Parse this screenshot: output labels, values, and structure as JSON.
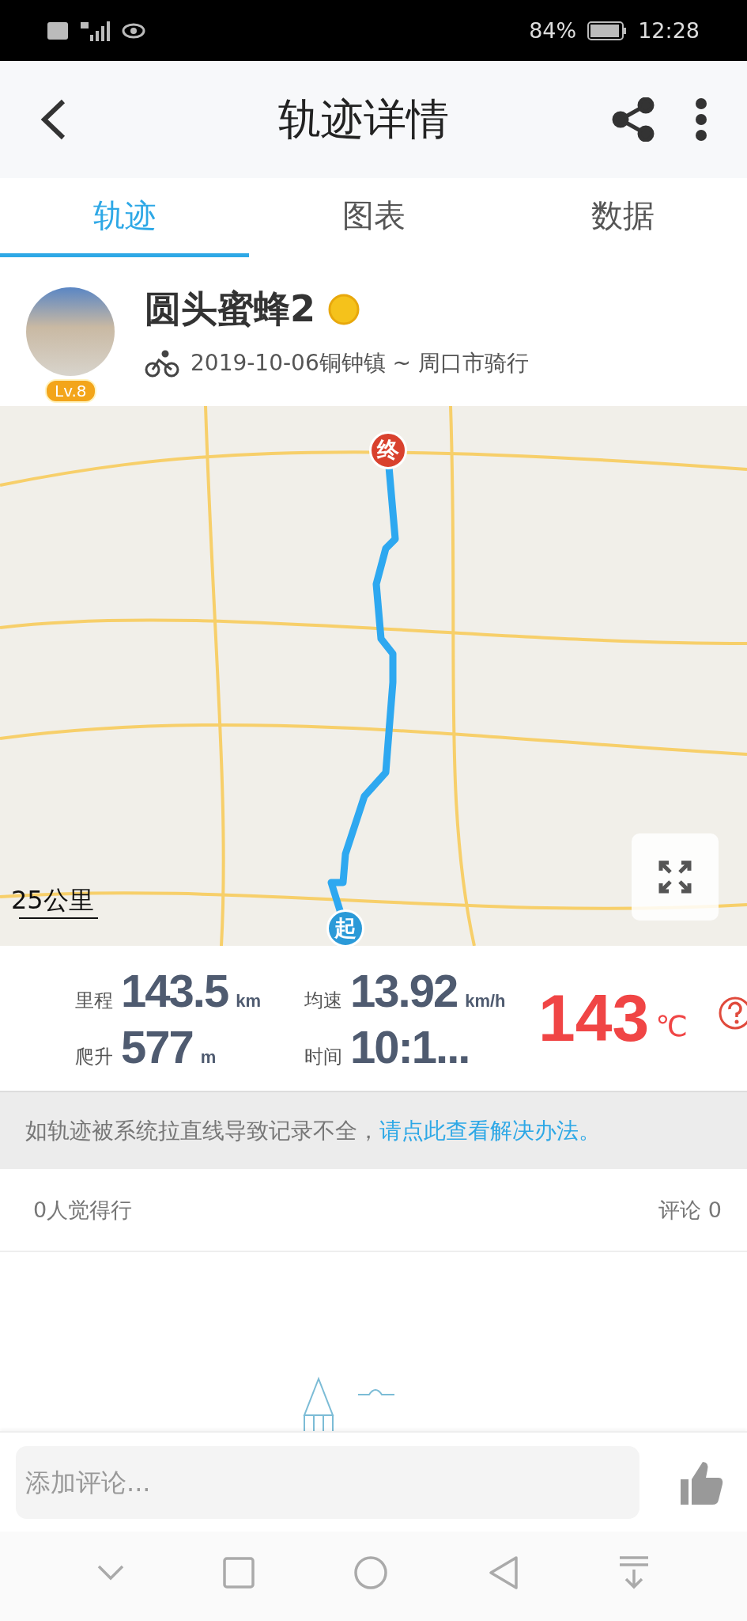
{
  "status_bar": {
    "battery": "84%",
    "time": "12:28"
  },
  "header": {
    "title": "轨迹详情"
  },
  "tabs": [
    {
      "label": "轨迹",
      "selected": true
    },
    {
      "label": "图表",
      "selected": false
    },
    {
      "label": "数据",
      "selected": false
    }
  ],
  "profile": {
    "name": "圆头蜜蜂2",
    "level": "Lv.8",
    "subtitle": "2019-10-06铜钟镇 ~ 周口市骑行"
  },
  "map": {
    "end_label": "终",
    "start_label": "起",
    "scale": "25公里"
  },
  "stats": [
    {
      "label": "里程",
      "value": "143.5",
      "unit": "km"
    },
    {
      "label": "均速",
      "value": "13.92",
      "unit": "km/h"
    },
    {
      "label": "爬升",
      "value": "577",
      "unit": "m"
    },
    {
      "label": "时间",
      "value": "10:1..."
    }
  ],
  "temperature": {
    "value": "143",
    "unit": "℃"
  },
  "notice": {
    "text": "如轨迹被系统拉直线导致记录不全，",
    "link": "请点此查看解决办法。"
  },
  "social": {
    "likes": "0人觉得行",
    "comments": "评论 0"
  },
  "comment": {
    "placeholder": "添加评论..."
  }
}
